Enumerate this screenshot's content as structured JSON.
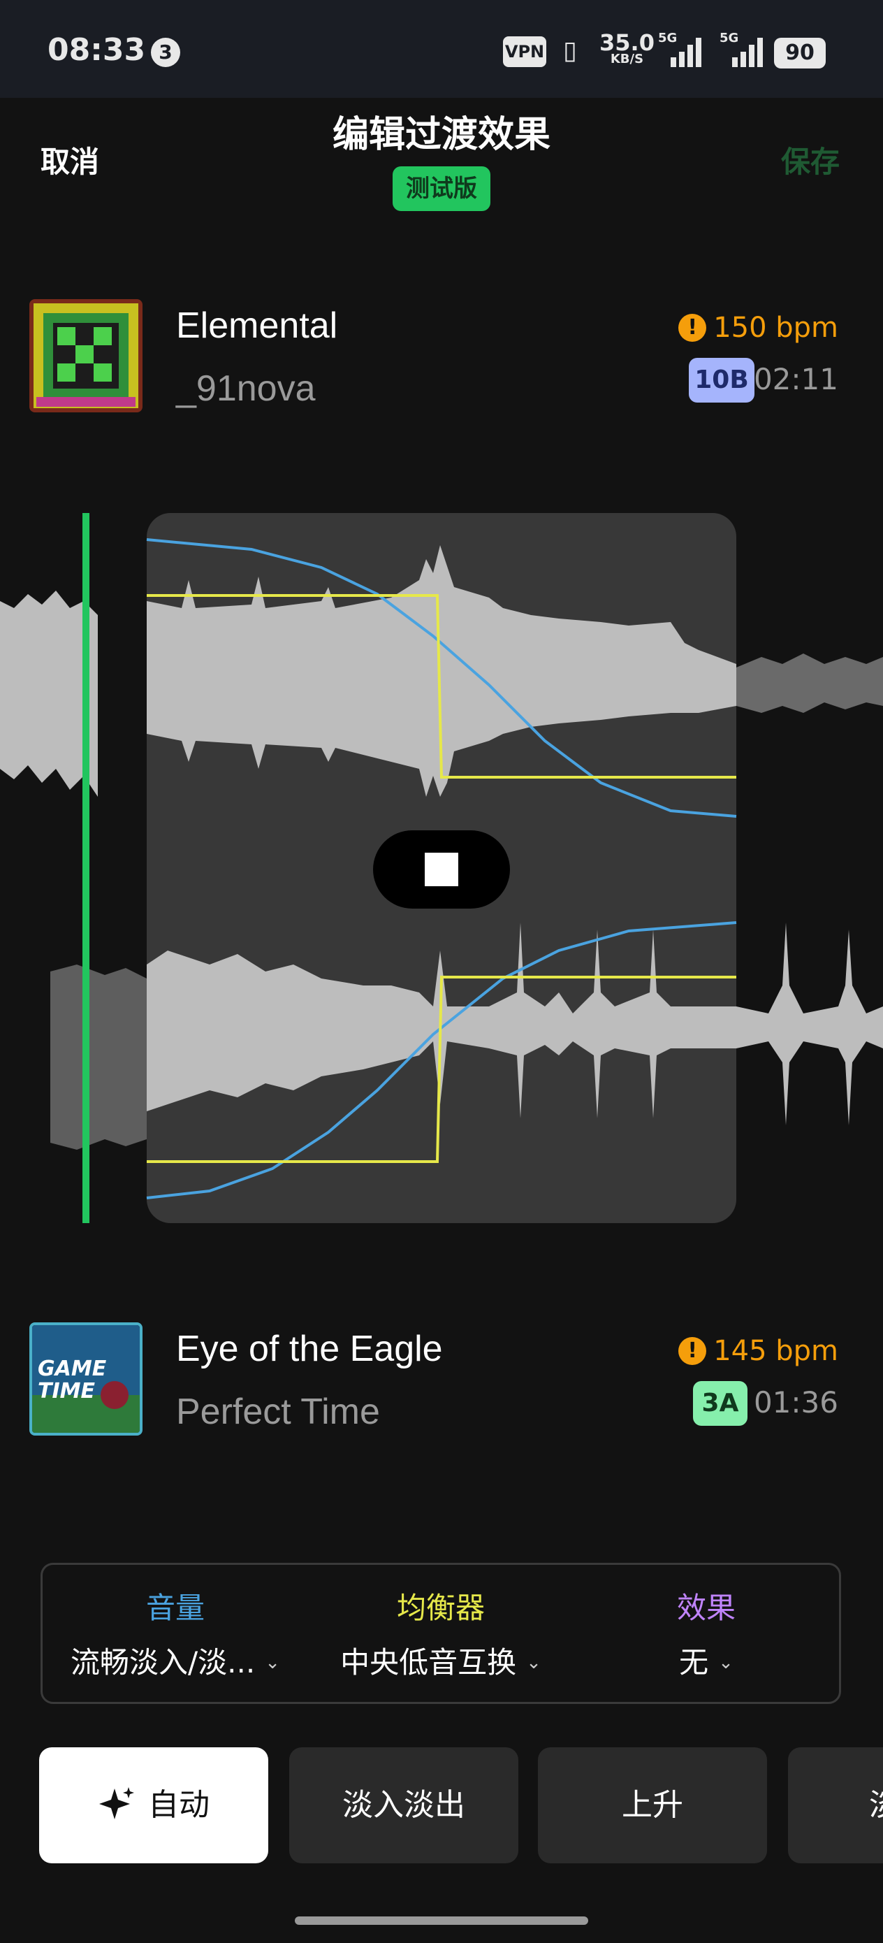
{
  "status_bar": {
    "time": "08:33",
    "notification_count": "3",
    "vpn": "VPN",
    "speed_value": "35.0",
    "speed_unit": "KB/S",
    "net1": "5G",
    "net2": "5G",
    "battery": "90"
  },
  "header": {
    "cancel": "取消",
    "title": "编辑过渡效果",
    "beta": "测试版",
    "save": "保存"
  },
  "track_from": {
    "title": "Elemental",
    "artist": "_91nova",
    "bpm": "150 bpm",
    "key": "10B",
    "duration": "02:11",
    "key_color": "#a5b4fc"
  },
  "track_to": {
    "title": "Eye of the Eagle",
    "artist": "Perfect Time",
    "bpm": "145 bpm",
    "key": "3A",
    "duration": "01:36",
    "key_color": "#86efac",
    "art_text": "GAME TIME"
  },
  "colors": {
    "accent_green": "#22c55e",
    "volume_curve": "#4aa3e0",
    "eq_curve": "#e6e84a",
    "warning": "#f59e0b"
  },
  "tabs": [
    {
      "category": "音量",
      "value": "流畅淡入/淡...",
      "color": "#4aa3e0"
    },
    {
      "category": "均衡器",
      "value": "中央低音互换",
      "color": "#e6e84a"
    },
    {
      "category": "效果",
      "value": "无",
      "color": "#c084fc"
    }
  ],
  "presets": [
    {
      "label": "自动",
      "icon": "sparkle-icon"
    },
    {
      "label": "淡入淡出"
    },
    {
      "label": "上升"
    },
    {
      "label": "淡"
    }
  ],
  "stop_icon": "stop-icon"
}
